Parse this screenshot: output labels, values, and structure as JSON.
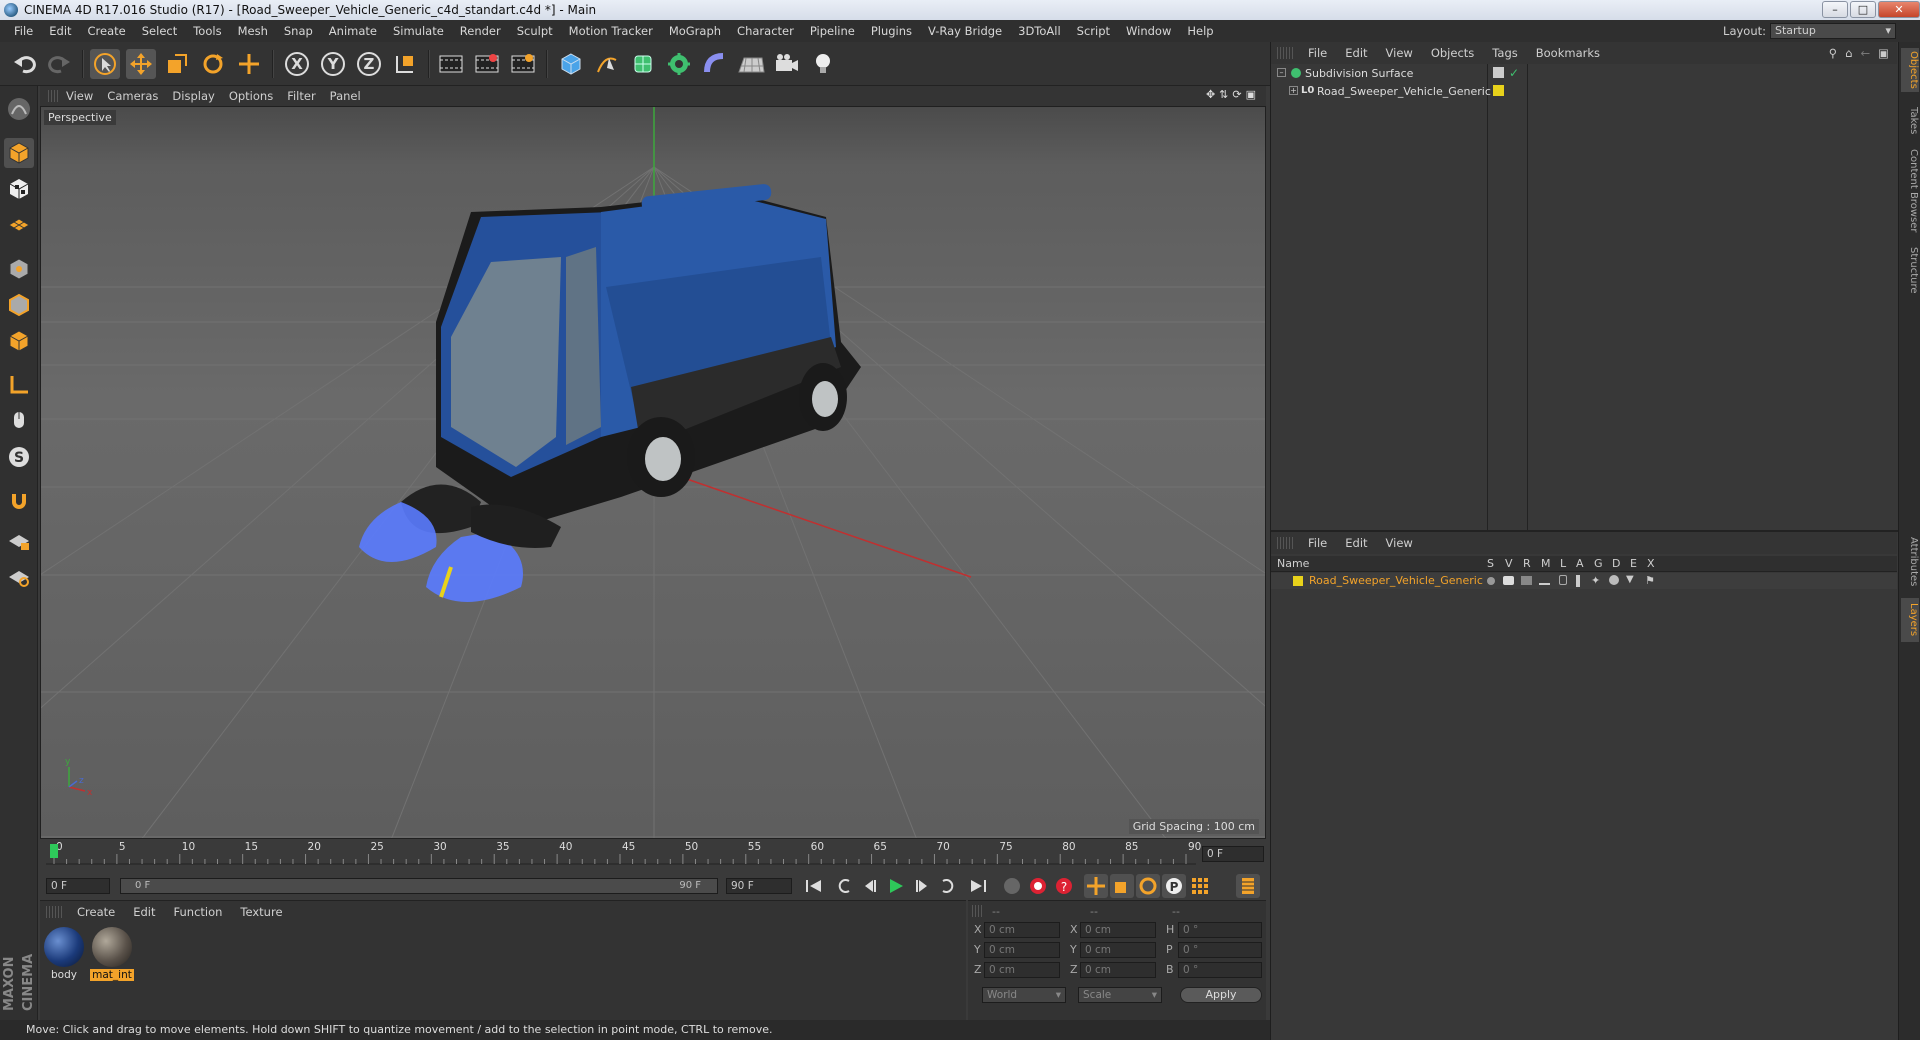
{
  "window": {
    "title": "CINEMA 4D R17.016 Studio (R17) - [Road_Sweeper_Vehicle_Generic_c4d_standart.c4d *] - Main"
  },
  "menubar": {
    "items": [
      "File",
      "Edit",
      "Create",
      "Select",
      "Tools",
      "Mesh",
      "Snap",
      "Animate",
      "Simulate",
      "Render",
      "Sculpt",
      "Motion Tracker",
      "MoGraph",
      "Character",
      "Pipeline",
      "Plugins",
      "V-Ray Bridge",
      "3DToAll",
      "Script",
      "Window",
      "Help"
    ],
    "layout_label": "Layout:",
    "layout_value": "Startup"
  },
  "viewport": {
    "menu": [
      "View",
      "Cameras",
      "Display",
      "Options",
      "Filter",
      "Panel"
    ],
    "label": "Perspective",
    "grid_spacing": "Grid Spacing : 100 cm",
    "axis_x": "x",
    "axis_y": "y",
    "axis_z": "z"
  },
  "timeline": {
    "ticks": [
      "0",
      "5",
      "10",
      "15",
      "20",
      "25",
      "30",
      "35",
      "40",
      "45",
      "50",
      "55",
      "60",
      "65",
      "70",
      "75",
      "80",
      "85",
      "90"
    ],
    "current_frame": "0 F",
    "start_field": "0 F",
    "range_start": "0 F",
    "range_end": "90 F",
    "end_field": "90 F"
  },
  "materials": {
    "menu": [
      "Create",
      "Edit",
      "Function",
      "Texture"
    ],
    "items": [
      {
        "name": "body"
      },
      {
        "name": "mat_int"
      }
    ]
  },
  "attributes": {
    "header": [
      "--",
      "--",
      "--"
    ],
    "rows": [
      {
        "a": "X",
        "av": "0 cm",
        "b": "X",
        "bv": "0 cm",
        "c": "H",
        "cv": "0 °"
      },
      {
        "a": "Y",
        "av": "0 cm",
        "b": "Y",
        "bv": "0 cm",
        "c": "P",
        "cv": "0 °"
      },
      {
        "a": "Z",
        "av": "0 cm",
        "b": "Z",
        "bv": "0 cm",
        "c": "B",
        "cv": "0 °"
      }
    ],
    "coord_mode": "World",
    "size_mode": "Scale",
    "apply": "Apply"
  },
  "objects": {
    "menu": [
      "File",
      "Edit",
      "View",
      "Objects",
      "Tags",
      "Bookmarks"
    ],
    "tree": [
      {
        "name": "Subdivision Surface"
      },
      {
        "name": "Road_Sweeper_Vehicle_Generic"
      }
    ]
  },
  "layers": {
    "menu": [
      "File",
      "Edit",
      "View"
    ],
    "col_name": "Name",
    "cols": [
      "S",
      "V",
      "R",
      "M",
      "L",
      "A",
      "G",
      "D",
      "E",
      "X"
    ],
    "rows": [
      {
        "name": "Road_Sweeper_Vehicle_Generic",
        "color": "#e8d21b"
      }
    ]
  },
  "right_tabs": [
    "Objects",
    "Takes",
    "Content Browser",
    "Structure",
    "Attributes",
    "Layers"
  ],
  "status": "Move: Click and drag to move elements. Hold down SHIFT to quantize movement / add to the selection in point mode, CTRL to remove.",
  "colors": {
    "accent": "#f3a32a",
    "layer_color": "#e8d21b",
    "brush_blue": "#5a7bff",
    "vehicle_blue": "#1f4f9b"
  }
}
